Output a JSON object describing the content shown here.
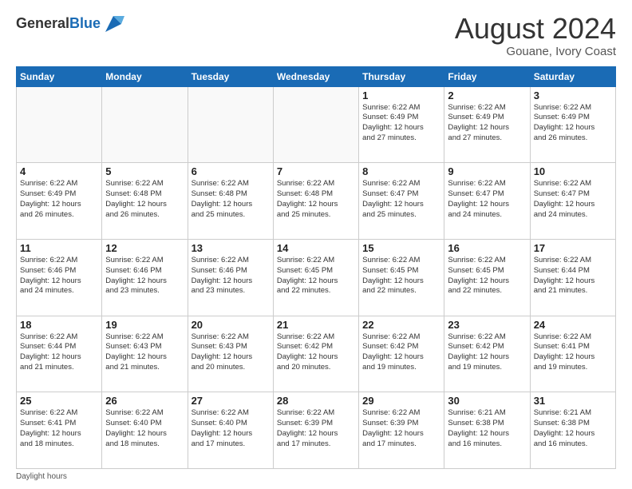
{
  "header": {
    "logo_general": "General",
    "logo_blue": "Blue",
    "month": "August 2024",
    "location": "Gouane, Ivory Coast"
  },
  "days_of_week": [
    "Sunday",
    "Monday",
    "Tuesday",
    "Wednesday",
    "Thursday",
    "Friday",
    "Saturday"
  ],
  "weeks": [
    [
      {
        "day": "",
        "info": ""
      },
      {
        "day": "",
        "info": ""
      },
      {
        "day": "",
        "info": ""
      },
      {
        "day": "",
        "info": ""
      },
      {
        "day": "1",
        "info": "Sunrise: 6:22 AM\nSunset: 6:49 PM\nDaylight: 12 hours\nand 27 minutes."
      },
      {
        "day": "2",
        "info": "Sunrise: 6:22 AM\nSunset: 6:49 PM\nDaylight: 12 hours\nand 27 minutes."
      },
      {
        "day": "3",
        "info": "Sunrise: 6:22 AM\nSunset: 6:49 PM\nDaylight: 12 hours\nand 26 minutes."
      }
    ],
    [
      {
        "day": "4",
        "info": "Sunrise: 6:22 AM\nSunset: 6:49 PM\nDaylight: 12 hours\nand 26 minutes."
      },
      {
        "day": "5",
        "info": "Sunrise: 6:22 AM\nSunset: 6:48 PM\nDaylight: 12 hours\nand 26 minutes."
      },
      {
        "day": "6",
        "info": "Sunrise: 6:22 AM\nSunset: 6:48 PM\nDaylight: 12 hours\nand 25 minutes."
      },
      {
        "day": "7",
        "info": "Sunrise: 6:22 AM\nSunset: 6:48 PM\nDaylight: 12 hours\nand 25 minutes."
      },
      {
        "day": "8",
        "info": "Sunrise: 6:22 AM\nSunset: 6:47 PM\nDaylight: 12 hours\nand 25 minutes."
      },
      {
        "day": "9",
        "info": "Sunrise: 6:22 AM\nSunset: 6:47 PM\nDaylight: 12 hours\nand 24 minutes."
      },
      {
        "day": "10",
        "info": "Sunrise: 6:22 AM\nSunset: 6:47 PM\nDaylight: 12 hours\nand 24 minutes."
      }
    ],
    [
      {
        "day": "11",
        "info": "Sunrise: 6:22 AM\nSunset: 6:46 PM\nDaylight: 12 hours\nand 24 minutes."
      },
      {
        "day": "12",
        "info": "Sunrise: 6:22 AM\nSunset: 6:46 PM\nDaylight: 12 hours\nand 23 minutes."
      },
      {
        "day": "13",
        "info": "Sunrise: 6:22 AM\nSunset: 6:46 PM\nDaylight: 12 hours\nand 23 minutes."
      },
      {
        "day": "14",
        "info": "Sunrise: 6:22 AM\nSunset: 6:45 PM\nDaylight: 12 hours\nand 22 minutes."
      },
      {
        "day": "15",
        "info": "Sunrise: 6:22 AM\nSunset: 6:45 PM\nDaylight: 12 hours\nand 22 minutes."
      },
      {
        "day": "16",
        "info": "Sunrise: 6:22 AM\nSunset: 6:45 PM\nDaylight: 12 hours\nand 22 minutes."
      },
      {
        "day": "17",
        "info": "Sunrise: 6:22 AM\nSunset: 6:44 PM\nDaylight: 12 hours\nand 21 minutes."
      }
    ],
    [
      {
        "day": "18",
        "info": "Sunrise: 6:22 AM\nSunset: 6:44 PM\nDaylight: 12 hours\nand 21 minutes."
      },
      {
        "day": "19",
        "info": "Sunrise: 6:22 AM\nSunset: 6:43 PM\nDaylight: 12 hours\nand 21 minutes."
      },
      {
        "day": "20",
        "info": "Sunrise: 6:22 AM\nSunset: 6:43 PM\nDaylight: 12 hours\nand 20 minutes."
      },
      {
        "day": "21",
        "info": "Sunrise: 6:22 AM\nSunset: 6:42 PM\nDaylight: 12 hours\nand 20 minutes."
      },
      {
        "day": "22",
        "info": "Sunrise: 6:22 AM\nSunset: 6:42 PM\nDaylight: 12 hours\nand 19 minutes."
      },
      {
        "day": "23",
        "info": "Sunrise: 6:22 AM\nSunset: 6:42 PM\nDaylight: 12 hours\nand 19 minutes."
      },
      {
        "day": "24",
        "info": "Sunrise: 6:22 AM\nSunset: 6:41 PM\nDaylight: 12 hours\nand 19 minutes."
      }
    ],
    [
      {
        "day": "25",
        "info": "Sunrise: 6:22 AM\nSunset: 6:41 PM\nDaylight: 12 hours\nand 18 minutes."
      },
      {
        "day": "26",
        "info": "Sunrise: 6:22 AM\nSunset: 6:40 PM\nDaylight: 12 hours\nand 18 minutes."
      },
      {
        "day": "27",
        "info": "Sunrise: 6:22 AM\nSunset: 6:40 PM\nDaylight: 12 hours\nand 17 minutes."
      },
      {
        "day": "28",
        "info": "Sunrise: 6:22 AM\nSunset: 6:39 PM\nDaylight: 12 hours\nand 17 minutes."
      },
      {
        "day": "29",
        "info": "Sunrise: 6:22 AM\nSunset: 6:39 PM\nDaylight: 12 hours\nand 17 minutes."
      },
      {
        "day": "30",
        "info": "Sunrise: 6:21 AM\nSunset: 6:38 PM\nDaylight: 12 hours\nand 16 minutes."
      },
      {
        "day": "31",
        "info": "Sunrise: 6:21 AM\nSunset: 6:38 PM\nDaylight: 12 hours\nand 16 minutes."
      }
    ]
  ],
  "footer": {
    "note": "Daylight hours"
  }
}
